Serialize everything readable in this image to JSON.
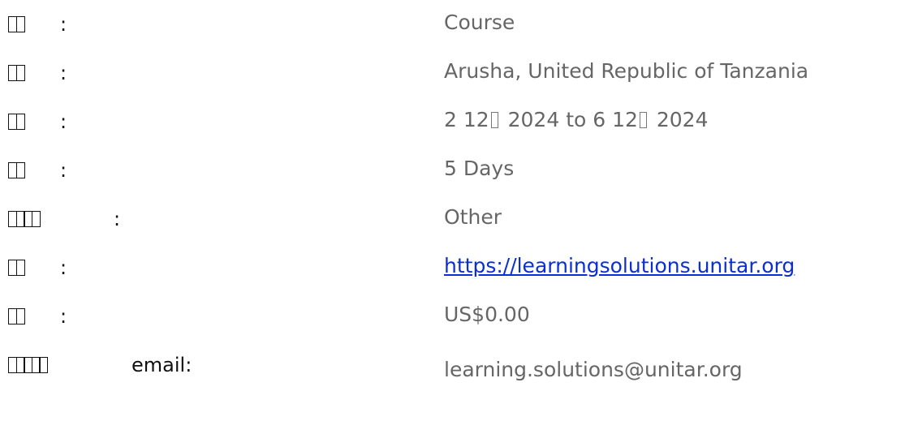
{
  "rows": [
    {
      "label_boxes": 2,
      "colon": ":",
      "value": "Course"
    },
    {
      "label_boxes": 2,
      "colon": ":",
      "value": "Arusha, United Republic of Tanzania"
    },
    {
      "label_boxes": 2,
      "colon": ":",
      "date_start_day": "2 12",
      "date_start_year": "2024 to 6 12",
      "date_end_year": "2024"
    },
    {
      "label_boxes": 2,
      "colon": ":",
      "value": "5 Days"
    },
    {
      "label_boxes": 4,
      "colon": ":",
      "value": "Other"
    },
    {
      "label_boxes": 2,
      "colon": ":",
      "link": "https://learningsolutions.unitar.org"
    },
    {
      "label_boxes": 2,
      "colon": ":",
      "value": "US$0.00"
    },
    {
      "label_boxes": 5,
      "label_suffix": "email:",
      "value": "learning.solutions@unitar.org"
    }
  ],
  "colors": {
    "label": "#111111",
    "value": "#666666",
    "link": "#0b2fd1"
  }
}
